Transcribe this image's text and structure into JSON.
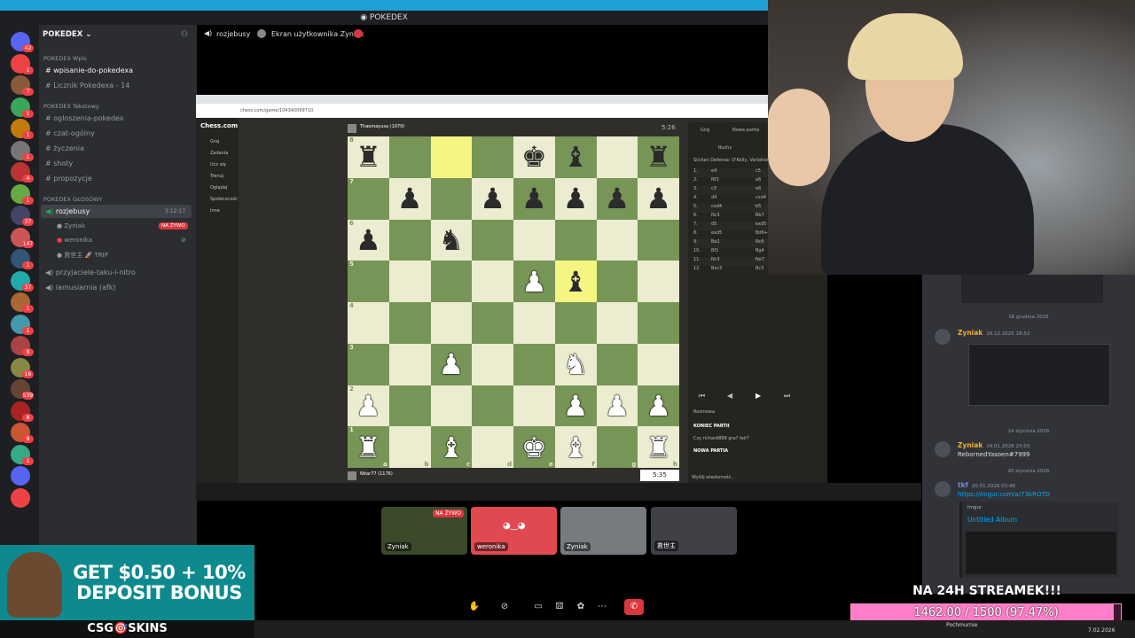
{
  "window": {
    "title": "POKEDEX"
  },
  "server": {
    "name": "POKEDEX",
    "categories": [
      {
        "name": "POKEDEX Wpis",
        "channels": [
          "wpisanie-do-pokedexa",
          "Licznik Pokedexa - 14"
        ]
      },
      {
        "name": "POKEDEX Tekstowy",
        "channels": [
          "ogloszenia-pokedex",
          "czat-ogólny",
          "życzenia",
          "shoty",
          "propozycje"
        ]
      },
      {
        "name": "POKEDEX GŁOSOWY",
        "channels": [
          "rozjebusy",
          "przyjaciele-taku-i-nitro",
          "lamusiarnia (afk)"
        ]
      }
    ],
    "voice_timer": "3:12:17",
    "voice_users": [
      "Zyniak",
      "weronika",
      "救世主 🚀 TRIP"
    ],
    "live_badge": "NA ŻYWO"
  },
  "guild_badges": [
    "42",
    "1",
    "7",
    "1",
    "1",
    "1",
    "4",
    "1",
    "37",
    "147",
    "1",
    "37",
    "1",
    "1",
    "8",
    "16",
    "539",
    "8",
    "9",
    "1"
  ],
  "stage": {
    "channel": "rozjebusy",
    "screen_label": "Ekran użytkownika Zyniak"
  },
  "chess": {
    "url": "chess.com/game/104340099710",
    "site": "Chess.com",
    "nav": [
      "Graj",
      "Zadania",
      "Ucz się",
      "Trenuj",
      "Oglądaj",
      "Społeczność",
      "Inne"
    ],
    "top_player": "Thaemayusa (1079)",
    "top_clock": "5:26",
    "bottom_player": "Nitar77 (1176)",
    "bottom_clock": "5:35",
    "opening": "Sicilian Defense: O'Kelly, Variation, Steinitz Line",
    "tabs": [
      "Graj",
      "Nowa partia"
    ],
    "moves_label": "Ruchy",
    "moves": [
      [
        "1.",
        "e4",
        "c5"
      ],
      [
        "2.",
        "Nf3",
        "a6"
      ],
      [
        "3.",
        "c3",
        "e6"
      ],
      [
        "4.",
        "d4",
        "cxd4"
      ],
      [
        "5.",
        "cxd4",
        "b5"
      ],
      [
        "6.",
        "Nc3",
        "Bb7"
      ],
      [
        "7.",
        "d5",
        "exd5"
      ],
      [
        "8.",
        "exd5",
        "Bd6+"
      ],
      [
        "9.",
        "Be2",
        "Nc6"
      ],
      [
        "10.",
        "Bf1",
        "Bg4"
      ],
      [
        "11.",
        "Nc3",
        "Ne7"
      ],
      [
        "12.",
        "Bxc3",
        "Bc3"
      ]
    ],
    "chat_label": "Rozmowa",
    "chat_lines": [
      "KONIEC PARTII",
      "Czy richard888 gra? fair?",
      "NOWA PARTIA"
    ],
    "chat_placeholder": "Wyślij wiadomość..."
  },
  "board": [
    [
      "r",
      "",
      "",
      "",
      "k",
      "b",
      "",
      "r"
    ],
    [
      "",
      "p",
      "",
      "p",
      "p",
      "p",
      "p",
      "p"
    ],
    [
      "p",
      "",
      "n",
      "",
      "",
      "",
      "",
      ""
    ],
    [
      "",
      "",
      "",
      "",
      "P",
      "b",
      "",
      ""
    ],
    [
      "",
      "",
      "",
      "",
      "",
      "",
      "",
      ""
    ],
    [
      "",
      "",
      "P",
      "",
      "",
      "N",
      "",
      ""
    ],
    [
      "P",
      "",
      "",
      "",
      "",
      "P",
      "P",
      "P"
    ],
    [
      "R",
      "",
      "B",
      "",
      "K",
      "B",
      "",
      "R"
    ]
  ],
  "board_highlight": [
    "c8",
    "f5"
  ],
  "participants": [
    {
      "name": "Zyniak",
      "badge": "NA ŻYWO",
      "color": "#3a4a2a"
    },
    {
      "name": "weronika",
      "badge": "",
      "color": "#e0494f"
    },
    {
      "name": "Zyniak",
      "badge": "",
      "color": "#777b80"
    },
    {
      "name": "救世主",
      "badge": "",
      "color": "#3f4146"
    }
  ],
  "chat": {
    "dates": [
      "16 grudnia 2025",
      "14 stycznia 2026",
      "20 stycznia 2026"
    ],
    "messages": [
      {
        "author": "Zyniak",
        "time": "16.12.2025 18:52",
        "text": "",
        "color": "#f0b132"
      },
      {
        "author": "Zyniak",
        "time": "14.01.2026 23:03",
        "text": "RebornedYasoen#7999",
        "color": "#f0b132"
      },
      {
        "author": "tkf",
        "time": "20.01.2026 03:48",
        "text": "https://imgur.com/a/73kROTD",
        "color": "#5865f2"
      }
    ],
    "embed_site": "Imgur",
    "embed_title": "Untitled Album"
  },
  "promo": {
    "text": "GET $0.50 + 10% DEPOSIT BONUS",
    "brand": "CSG🎯SKINS"
  },
  "goal": {
    "title": "NA 24H STREAMEK!!!",
    "text": "1462.00 / 1500 (97.47%)",
    "fraction": 0.9747
  },
  "taskbar": {
    "weather": "Pochmurnie",
    "date": "7.02.2026"
  }
}
